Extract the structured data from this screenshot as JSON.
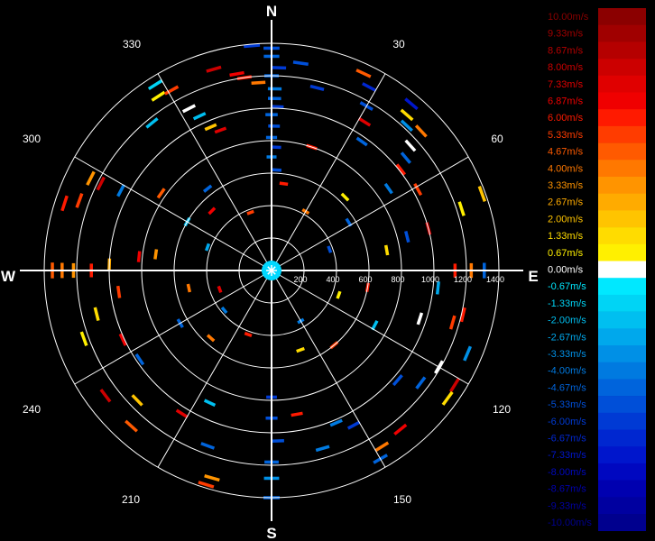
{
  "compass": {
    "north": "N",
    "south": "S",
    "east": "E",
    "west": "W"
  },
  "azimuth_labels": [
    "30",
    "60",
    "120",
    "150",
    "210",
    "240",
    "300",
    "330"
  ],
  "range_labels": [
    "200",
    "400",
    "600",
    "800",
    "1000",
    "1200",
    "1400"
  ],
  "colors": {
    "background": "#000000",
    "grid": "#ffffff",
    "axis": "#ffffff",
    "label_text": "#ffffff"
  },
  "chart_data": {
    "type": "polar-heatmap",
    "title": "",
    "angle_unit": "degrees clockwise from north",
    "range_ticks": [
      200,
      400,
      600,
      800,
      1000,
      1200,
      1400
    ],
    "range_max": 1400,
    "azimuth_ticks": [
      30,
      60,
      120,
      150,
      210,
      240,
      300,
      330
    ],
    "grid": true,
    "legend_placement": "right",
    "colorscale": [
      {
        "label": "10.00m/s",
        "color": "#8b0000"
      },
      {
        "label": "9.33m/s",
        "color": "#a00000"
      },
      {
        "label": "8.67m/s",
        "color": "#b50000"
      },
      {
        "label": "8.00m/s",
        "color": "#cc0000"
      },
      {
        "label": "7.33m/s",
        "color": "#e00000"
      },
      {
        "label": "6.87m/s",
        "color": "#f00000"
      },
      {
        "label": "6.00m/s",
        "color": "#ff1a00"
      },
      {
        "label": "5.33m/s",
        "color": "#ff3c00"
      },
      {
        "label": "4.67m/s",
        "color": "#ff5a00"
      },
      {
        "label": "4.00m/s",
        "color": "#ff7800"
      },
      {
        "label": "3.33m/s",
        "color": "#ff9400"
      },
      {
        "label": "2.67m/s",
        "color": "#ffab00"
      },
      {
        "label": "2.00m/s",
        "color": "#ffc400"
      },
      {
        "label": "1.33m/s",
        "color": "#ffdc00"
      },
      {
        "label": "0.67m/s",
        "color": "#fff000"
      },
      {
        "label": "0.00m/s",
        "color": "#ffffff"
      },
      {
        "label": "-0.67m/s",
        "color": "#00e8ff"
      },
      {
        "label": "-1.33m/s",
        "color": "#00d4f5"
      },
      {
        "label": "-2.00m/s",
        "color": "#00bff0"
      },
      {
        "label": "-2.67m/s",
        "color": "#00a8ec"
      },
      {
        "label": "-3.33m/s",
        "color": "#0090e6"
      },
      {
        "label": "-4.00m/s",
        "color": "#007ae0"
      },
      {
        "label": "-4.67m/s",
        "color": "#0064dc"
      },
      {
        "label": "-5.33m/s",
        "color": "#004fd8"
      },
      {
        "label": "-6.00m/s",
        "color": "#003ad4"
      },
      {
        "label": "-6.67m/s",
        "color": "#0027d0"
      },
      {
        "label": "-7.33m/s",
        "color": "#0016cc"
      },
      {
        "label": "-8.00m/s",
        "color": "#0008c0"
      },
      {
        "label": "-8.67m/s",
        "color": "#0000b0"
      },
      {
        "label": "-9.33m/s",
        "color": "#0000a0"
      },
      {
        "label": "-10.00m/s",
        "color": "#00008e"
      }
    ],
    "cells": [
      {
        "az": 355,
        "r": 1390,
        "v": -6.0
      },
      {
        "az": 0,
        "r": 1370,
        "v": -5.3
      },
      {
        "az": 0,
        "r": 1320,
        "v": -4.7
      },
      {
        "az": 8,
        "r": 1290,
        "v": -5.3
      },
      {
        "az": 2,
        "r": 1250,
        "v": -6.0
      },
      {
        "az": 0,
        "r": 1200,
        "v": -4.7
      },
      {
        "az": 1,
        "r": 1120,
        "v": -4.0
      },
      {
        "az": 1,
        "r": 1060,
        "v": -4.7
      },
      {
        "az": 2,
        "r": 1010,
        "v": -6.0
      },
      {
        "az": 0,
        "r": 960,
        "v": -4.7
      },
      {
        "az": 1,
        "r": 890,
        "v": -5.3
      },
      {
        "az": 0,
        "r": 820,
        "v": -4.7
      },
      {
        "az": 2,
        "r": 760,
        "v": -6.0
      },
      {
        "az": 0,
        "r": 700,
        "v": -4.0
      },
      {
        "az": 3,
        "r": 620,
        "v": -5.3
      },
      {
        "az": 14,
        "r": 1160,
        "v": -6.0
      },
      {
        "az": -8,
        "r": 1200,
        "v": 6.0
      },
      {
        "az": -4,
        "r": 1160,
        "v": 4.0
      },
      {
        "az": 25,
        "r": 1340,
        "v": 4.7
      },
      {
        "az": 28,
        "r": 1280,
        "v": -6.7
      },
      {
        "az": 30,
        "r": 1170,
        "v": -5.3
      },
      {
        "az": 32,
        "r": 1080,
        "v": 7.3
      },
      {
        "az": 35,
        "r": 970,
        "v": -4.7
      },
      {
        "az": 40,
        "r": 1340,
        "v": -7.3
      },
      {
        "az": 41,
        "r": 1270,
        "v": 1.3
      },
      {
        "az": 43,
        "r": 1220,
        "v": -3.3
      },
      {
        "az": 47,
        "r": 1260,
        "v": 4.0
      },
      {
        "az": 48,
        "r": 1150,
        "v": 0.0
      },
      {
        "az": 50,
        "r": 1080,
        "v": -4.7
      },
      {
        "az": 52,
        "r": 1010,
        "v": 6.0
      },
      {
        "az": 55,
        "r": 880,
        "v": -4.0
      },
      {
        "az": 61,
        "r": 1030,
        "v": 5.3
      },
      {
        "az": 70,
        "r": 1380,
        "v": 2.0
      },
      {
        "az": 72,
        "r": 1230,
        "v": 0.7
      },
      {
        "az": 75,
        "r": 1000,
        "v": 8.0
      },
      {
        "az": 76,
        "r": 860,
        "v": -5.3
      },
      {
        "az": 80,
        "r": 720,
        "v": 1.3
      },
      {
        "az": 90,
        "r": 1310,
        "v": -4.7
      },
      {
        "az": 90,
        "r": 1230,
        "v": 4.0
      },
      {
        "az": 90,
        "r": 1130,
        "v": 6.0
      },
      {
        "az": 96,
        "r": 1030,
        "v": -2.7
      },
      {
        "az": 103,
        "r": 1210,
        "v": 6.0
      },
      {
        "az": 106,
        "r": 1160,
        "v": 5.3
      },
      {
        "az": 108,
        "r": 960,
        "v": 0.0
      },
      {
        "az": 113,
        "r": 1310,
        "v": -3.3
      },
      {
        "az": 120,
        "r": 1190,
        "v": 0.0
      },
      {
        "az": 122,
        "r": 1330,
        "v": 8.0
      },
      {
        "az": 126,
        "r": 1340,
        "v": 1.3
      },
      {
        "az": 127,
        "r": 1150,
        "v": -4.7
      },
      {
        "az": 131,
        "r": 1030,
        "v": -5.3
      },
      {
        "az": 141,
        "r": 1260,
        "v": 6.7
      },
      {
        "az": 148,
        "r": 1280,
        "v": 4.0
      },
      {
        "az": 150,
        "r": 1340,
        "v": -4.7
      },
      {
        "az": 152,
        "r": 1080,
        "v": -6.0
      },
      {
        "az": 157,
        "r": 1020,
        "v": -4.0
      },
      {
        "az": 164,
        "r": 1140,
        "v": -4.0
      },
      {
        "az": 170,
        "r": 900,
        "v": 6.0
      },
      {
        "az": 178,
        "r": 1050,
        "v": -5.3
      },
      {
        "az": 180,
        "r": 1180,
        "v": -4.7
      },
      {
        "az": 180,
        "r": 910,
        "v": -5.3
      },
      {
        "az": 180,
        "r": 780,
        "v": -6.0
      },
      {
        "az": 180,
        "r": 1280,
        "v": -3.3
      },
      {
        "az": 180,
        "r": 1400,
        "v": -4.7
      },
      {
        "az": 197,
        "r": 1380,
        "v": 5.3
      },
      {
        "az": 196,
        "r": 1330,
        "v": 3.3
      },
      {
        "az": 200,
        "r": 1150,
        "v": -4.7
      },
      {
        "az": 205,
        "r": 900,
        "v": -2.0
      },
      {
        "az": 212,
        "r": 1040,
        "v": 7.3
      },
      {
        "az": 222,
        "r": 1290,
        "v": 4.7
      },
      {
        "az": 226,
        "r": 1150,
        "v": 2.0
      },
      {
        "az": 233,
        "r": 1280,
        "v": 8.0
      },
      {
        "az": 236,
        "r": 980,
        "v": -4.7
      },
      {
        "az": 245,
        "r": 1010,
        "v": 6.7
      },
      {
        "az": 250,
        "r": 1230,
        "v": 0.7
      },
      {
        "az": 256,
        "r": 1110,
        "v": 1.3
      },
      {
        "az": 262,
        "r": 950,
        "v": 5.3
      },
      {
        "az": 270,
        "r": 1350,
        "v": 4.7
      },
      {
        "az": 270,
        "r": 1290,
        "v": 4.0
      },
      {
        "az": 270,
        "r": 1220,
        "v": 3.3
      },
      {
        "az": 270,
        "r": 1110,
        "v": 6.0
      },
      {
        "az": 272,
        "r": 1000,
        "v": 2.7
      },
      {
        "az": 276,
        "r": 820,
        "v": 6.7
      },
      {
        "az": 278,
        "r": 720,
        "v": 3.3
      },
      {
        "az": 288,
        "r": 1340,
        "v": 6.0
      },
      {
        "az": 290,
        "r": 1260,
        "v": 5.3
      },
      {
        "az": 297,
        "r": 1180,
        "v": 8.0
      },
      {
        "az": 297,
        "r": 1250,
        "v": 3.3
      },
      {
        "az": 298,
        "r": 1050,
        "v": -4.0
      },
      {
        "az": 305,
        "r": 830,
        "v": 4.7
      },
      {
        "az": 321,
        "r": 1170,
        "v": -2.0
      },
      {
        "az": 328,
        "r": 1350,
        "v": -1.3
      },
      {
        "az": 327,
        "r": 1280,
        "v": 0.7
      },
      {
        "az": 331,
        "r": 1270,
        "v": 5.3
      },
      {
        "az": 333,
        "r": 1120,
        "v": 0.0
      },
      {
        "az": 335,
        "r": 1050,
        "v": -2.0
      },
      {
        "az": 337,
        "r": 960,
        "v": 2.0
      },
      {
        "az": 344,
        "r": 1290,
        "v": 8.0
      },
      {
        "az": 350,
        "r": 1230,
        "v": 6.7
      },
      {
        "az": 340,
        "r": 920,
        "v": 7.3
      },
      {
        "az": 18,
        "r": 800,
        "v": 6.0
      },
      {
        "az": 45,
        "r": 640,
        "v": 0.7
      },
      {
        "az": 58,
        "r": 560,
        "v": -4.7
      },
      {
        "az": 100,
        "r": 600,
        "v": 6.0
      },
      {
        "az": 118,
        "r": 720,
        "v": -2.0
      },
      {
        "az": 140,
        "r": 600,
        "v": 5.3
      },
      {
        "az": 160,
        "r": 520,
        "v": 1.3
      },
      {
        "az": 222,
        "r": 560,
        "v": 4.0
      },
      {
        "az": 240,
        "r": 650,
        "v": -4.7
      },
      {
        "az": 258,
        "r": 520,
        "v": 4.0
      },
      {
        "az": 300,
        "r": 600,
        "v": -2.0
      },
      {
        "az": 315,
        "r": 520,
        "v": 6.7
      },
      {
        "az": 322,
        "r": 640,
        "v": -4.7
      },
      {
        "az": 8,
        "r": 540,
        "v": 6.0
      },
      {
        "az": 30,
        "r": 420,
        "v": 4.0
      },
      {
        "az": 70,
        "r": 380,
        "v": -5.3
      },
      {
        "az": 110,
        "r": 440,
        "v": 0.7
      },
      {
        "az": 150,
        "r": 360,
        "v": -4.0
      },
      {
        "az": 200,
        "r": 420,
        "v": 6.0
      },
      {
        "az": 230,
        "r": 380,
        "v": -4.0
      },
      {
        "az": 250,
        "r": 340,
        "v": 7.3
      },
      {
        "az": 290,
        "r": 420,
        "v": -2.7
      },
      {
        "az": 340,
        "r": 380,
        "v": 5.3
      }
    ]
  }
}
